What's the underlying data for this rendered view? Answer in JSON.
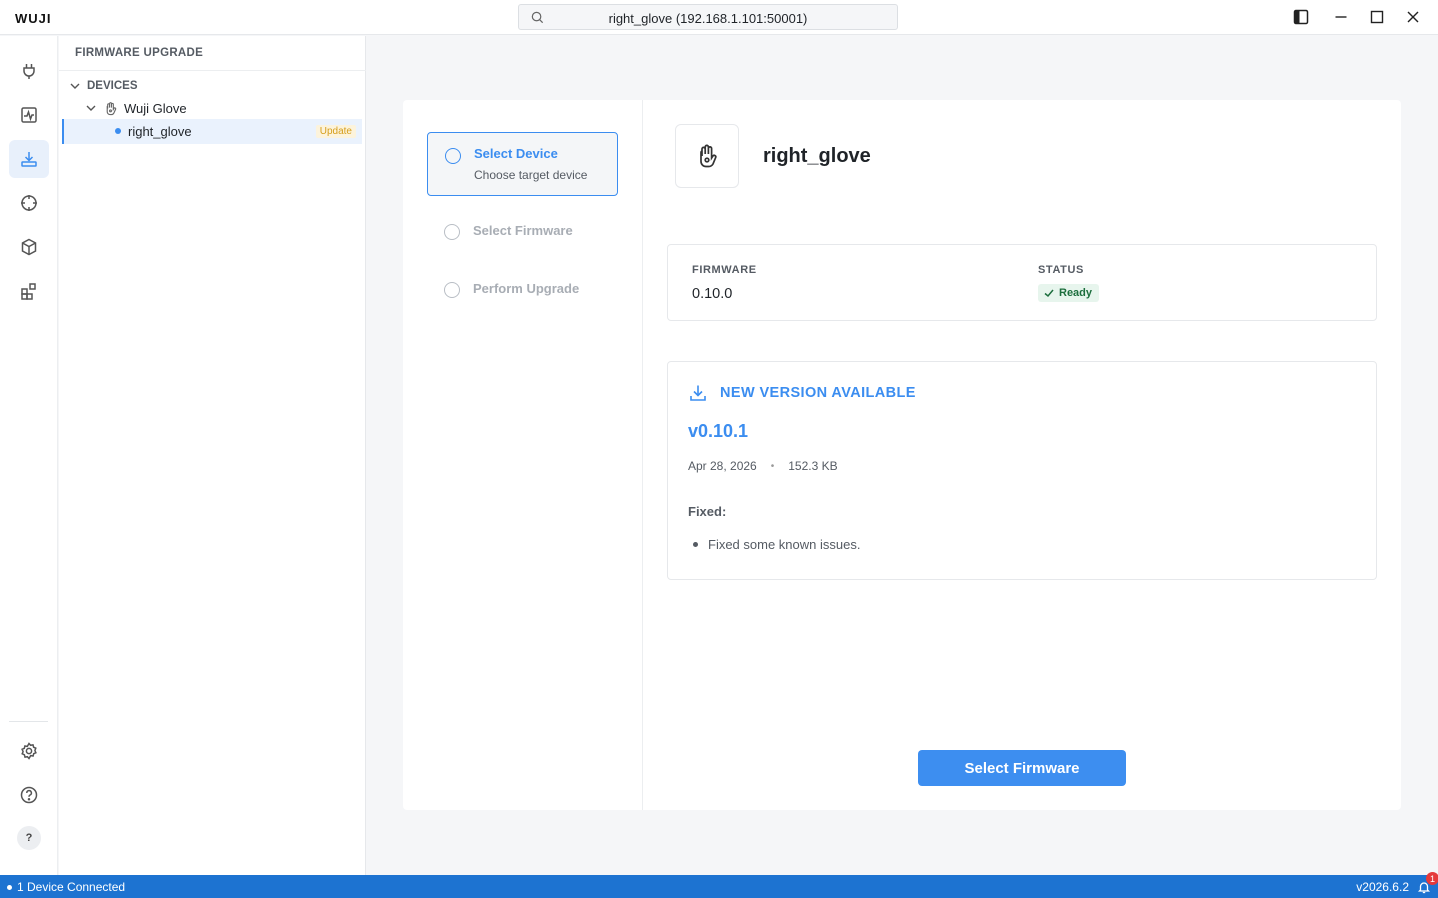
{
  "app": {
    "logo": "WUJI"
  },
  "search": {
    "text": "right_glove (192.168.1.101:50001)"
  },
  "explorer": {
    "header": "FIRMWARE UPGRADE",
    "section": "DEVICES",
    "group": "Wuji Glove",
    "device": {
      "name": "right_glove",
      "tag": "Update"
    }
  },
  "steps": [
    {
      "title": "Select Device",
      "subtitle": "Choose target device"
    },
    {
      "title": "Select Firmware"
    },
    {
      "title": "Perform Upgrade"
    }
  ],
  "device": {
    "name": "right_glove",
    "firmware_label": "FIRMWARE",
    "firmware_value": "0.10.0",
    "status_label": "STATUS",
    "status_value": "Ready"
  },
  "update": {
    "heading": "NEW VERSION AVAILABLE",
    "version": "v0.10.1",
    "date": "Apr 28, 2026",
    "size": "152.3 KB",
    "fixed_label": "Fixed:",
    "notes": [
      "Fixed some known issues."
    ]
  },
  "actions": {
    "select_firmware": "Select Firmware"
  },
  "statusbar": {
    "connection": "1 Device Connected",
    "version": "v2026.6.2",
    "notifications": "1"
  },
  "help_badge": "?",
  "colors": {
    "accent": "#3b8df0",
    "statusbar": "#1d73d1",
    "ready": "#1c6e3d",
    "update_tag": "#d69e1a"
  }
}
